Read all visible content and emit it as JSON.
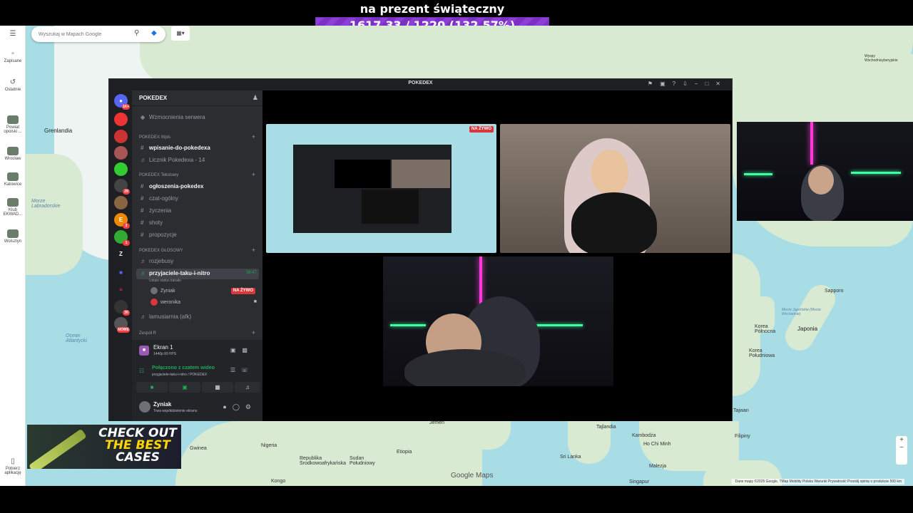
{
  "overlay": {
    "title": "na prezent świąteczny",
    "progress_text": "1617.33 / 1220 (132.57%)",
    "progress_fraction": 1.3257
  },
  "maps": {
    "search_placeholder": "Wyszukaj w Mapach Google",
    "rail": [
      {
        "label": "Zapisane"
      },
      {
        "label": "Ostatnie"
      },
      {
        "label": "Powiat opolski ..."
      },
      {
        "label": "Wrocław"
      },
      {
        "label": "Katowice"
      },
      {
        "label": "Klub EKWAD..."
      },
      {
        "label": "Wolsztyn"
      },
      {
        "label": "Pobierz aplikację"
      }
    ],
    "labels": {
      "greenland": "Grenlandia",
      "labrador": "Morze Labradorskie",
      "ocean": "Ocean Atlantycki",
      "korea": "Korea Północna",
      "korea_s": "Korea Południowa",
      "japan": "Japonia",
      "japan_sea": "Morze Japońskie (Morze Wschodnie)",
      "sapporo": "Sapporo",
      "taiwan": "Tajwan",
      "philippines": "Filipiny",
      "guinea": "Gwinea",
      "nigeria": "Nigeria",
      "ethiopia": "Etiopia",
      "car": "Republika Środkowoafrykańska",
      "south_sudan": "Sudan Południowy",
      "jemen": "Jemen",
      "sri_lanka": "Sri Lanka",
      "kambodza": "Kambodża",
      "ho_chi_minh": "Ho Chi Minh",
      "malezja": "Malezja",
      "singapur": "Singapur",
      "kongo": "Kongo",
      "tajlandia": "Tajlandia",
      "wyspy": "Wyspy Wschodnisyberyjskie",
      "warstwy": "Warstwy"
    },
    "google_logo": "Google Maps",
    "attribution": "Dane mapy ©2025 Google, TMap Mobility   Polska   Warunki   Prywatność   Prześlij opinię o produkcie   500 km"
  },
  "ad": {
    "line1": "CHECK OUT",
    "line2": "THE BEST",
    "line3": "CASES"
  },
  "discord": {
    "window_title": "POKEDEX",
    "server_name": "POKEDEX",
    "boosts": "Wzmocnienia serwera",
    "guild_badges": {
      "top": "1K+",
      "g4": "29",
      "g6": "3",
      "g8": "1",
      "g11": "30",
      "new": "NOWE"
    },
    "categories": [
      {
        "name": "POKEDEX Wpis"
      },
      {
        "name": "POKEDEX Tekstowy"
      },
      {
        "name": "POKEDEX GŁOSOWY"
      },
      {
        "name": "Zespół R"
      }
    ],
    "channels": {
      "wpisanie": "wpisanie-do-pokedexa",
      "licznik": "Licznik Pokedexa - 14",
      "ogloszenia": "ogłoszenia-pokedex",
      "czat": "czat-ogólny",
      "zyczenia": "życzenia",
      "shoty": "shoty",
      "propozycje": "propozycje",
      "rozjebusy": "rozjebusy",
      "przyjaciele": "przyjaciele-taku-i-nitro",
      "lamusiarnia": "lamusiarnia (afk)"
    },
    "voice": {
      "timer": "36:47",
      "status_hint": "Ustaw status kanału",
      "users": [
        {
          "name": "Zyniak",
          "badge": "NA ŻYWO"
        },
        {
          "name": "weronika"
        }
      ]
    },
    "stream_panel": {
      "title": "Ekran 1",
      "sub": "1440p 60 FPS"
    },
    "voice_panel": {
      "title": "Połączono z czatem wideo",
      "sub": "przyjaciele-taku-i-nitro / POKEDEX"
    },
    "user_panel": {
      "name": "Zyniak",
      "status": "Trwa współdzielenie ekranu"
    },
    "tile_live": "NA ŻYWO"
  },
  "colors": {
    "progress_purple": "#8b3fd6",
    "discord_bg": "#2b2d31",
    "discord_dark": "#1e1f22",
    "live_red": "#da373c",
    "connected_green": "#23a55a",
    "map_water": "#a9dde6",
    "map_land": "#d9ead3"
  }
}
